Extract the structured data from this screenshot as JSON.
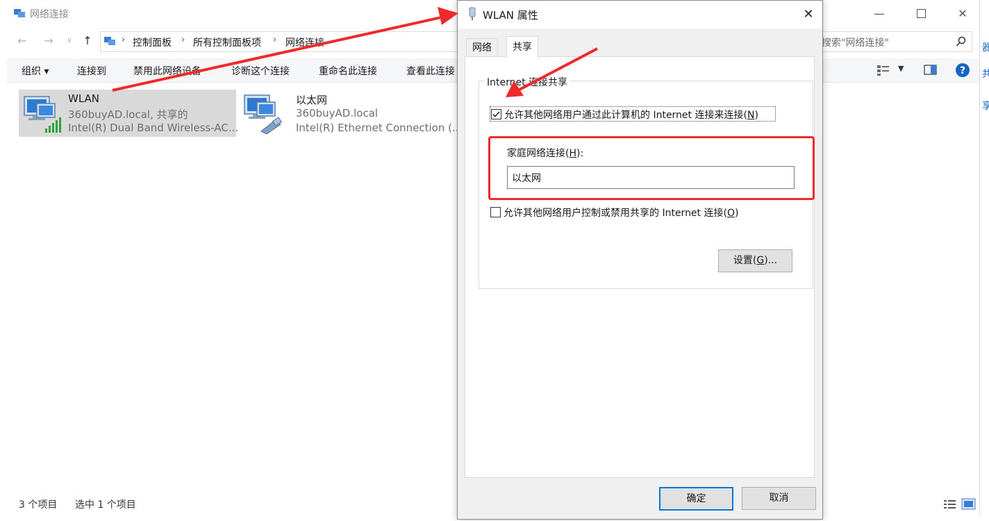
{
  "explorer": {
    "title": "网络连接",
    "breadcrumbs": [
      "控制面板",
      "所有控制面板项",
      "网络连接"
    ],
    "search_placeholder": "搜索\"网络连接\"",
    "commands": {
      "organize": "组织 ▾",
      "connect_to": "连接到",
      "disable": "禁用此网络设备",
      "diagnose": "诊断这个连接",
      "rename": "重命名此连接",
      "view_status": "查看此连接"
    },
    "items": [
      {
        "name": "WLAN",
        "domain": "360buyAD.local, 共享的",
        "adapter": "Intel(R) Dual Band Wireless-AC..."
      },
      {
        "name": "以太网",
        "domain": "360buyAD.local",
        "adapter": "Intel(R) Ethernet Connection (..."
      }
    ],
    "status": {
      "count": "3 个项目",
      "selected": "选中 1 个项目"
    }
  },
  "dialog": {
    "title": "WLAN 属性",
    "tabs": [
      "网络",
      "共享"
    ],
    "group_title": "Internet 连接共享",
    "allow_share": {
      "text": "允许其他网络用户通过此计算机的 Internet 连接来连接(",
      "key": "N",
      "end": ")",
      "checked": true
    },
    "home_label": {
      "text": "家庭网络连接(",
      "key": "H",
      "end": "):"
    },
    "home_value": "以太网",
    "allow_control": {
      "text": "允许其他网络用户控制或禁用共享的 Internet 连接(",
      "key": "O",
      "end": ")",
      "checked": false
    },
    "settings_button": {
      "text": "设置(",
      "key": "G",
      "end": ")..."
    },
    "ok": "确定",
    "cancel": "取消"
  },
  "colors": {
    "accent": "#0078d7",
    "highlight_red": "#ee2a2a",
    "selection": "#d9d9d9"
  }
}
